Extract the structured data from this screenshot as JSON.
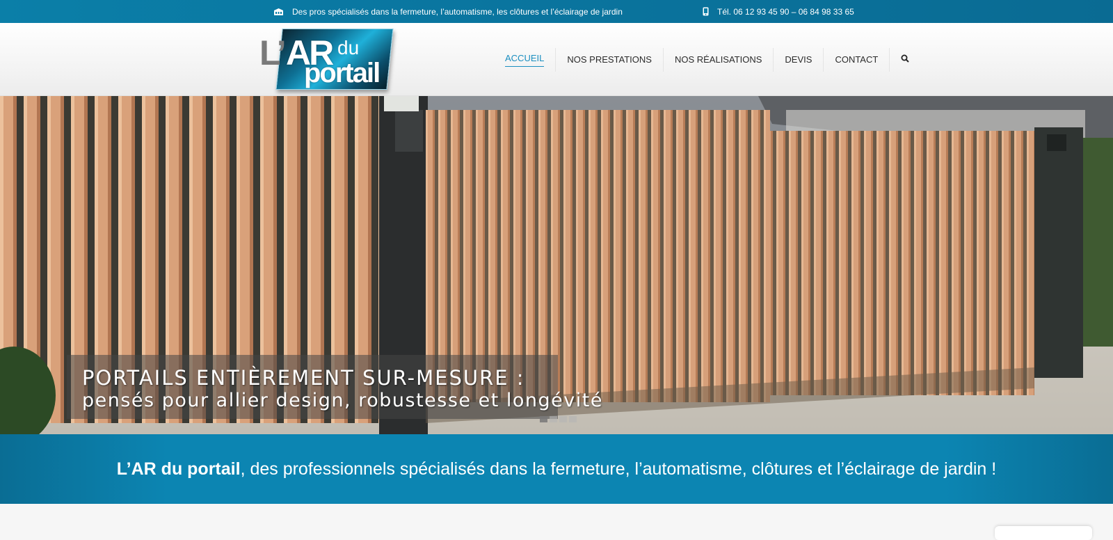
{
  "topbar": {
    "tagline": "Des pros spécialisés dans la fermeture, l’automatisme, les clôtures et l’éclairage de jardin",
    "phone": "Tél. 06 12 93 45 90 – 06 84 98 33 65"
  },
  "logo": {
    "text_l": "L’",
    "text_ar": "AR",
    "text_du": "du",
    "text_portail": "portail"
  },
  "nav": {
    "items": [
      {
        "label": "ACCUEIL",
        "active": true
      },
      {
        "label": "NOS PRESTATIONS",
        "active": false
      },
      {
        "label": "NOS RÉALISATIONS",
        "active": false
      },
      {
        "label": "DEVIS",
        "active": false
      },
      {
        "label": "CONTACT",
        "active": false
      }
    ]
  },
  "hero": {
    "caption_line1": "PORTAILS ENTIÈREMENT SUR-MESURE :",
    "caption_line2": "pensés pour allier design, robustesse et longévité",
    "dots": 4,
    "active_dot": 0
  },
  "band": {
    "brand": "L’AR du portail",
    "text": ", des professionnels spécialisés dans la fermeture, l’automatisme, clôtures et l’éclairage de jardin !"
  },
  "colors": {
    "brand_blue": "#0c85b2",
    "nav_active": "#1a8ec0"
  }
}
